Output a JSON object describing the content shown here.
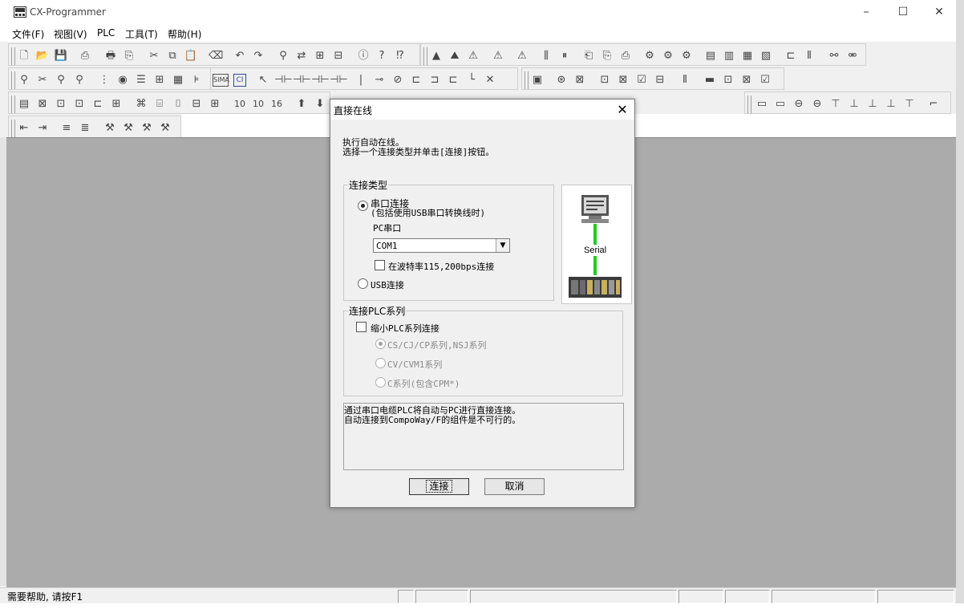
{
  "window": {
    "title": "CX-Programmer",
    "controls": {
      "minimize": "–",
      "maximize": "☐",
      "close": "✕"
    }
  },
  "menu": [
    {
      "label": "文件(F)"
    },
    {
      "label": "视图(V)"
    },
    {
      "label": "PLC"
    },
    {
      "label": "工具(T)"
    },
    {
      "label": "帮助(H)"
    }
  ],
  "toolbar": {
    "row2_labels": {
      "simatic": "SIMA",
      "ci": "CI"
    },
    "row3_labels": {
      "n10a": "10",
      "n10b": "10",
      "n16": "16"
    },
    "icons": [
      "new-file-icon",
      "open-folder-icon",
      "save-icon",
      "print-icon",
      "cut-icon",
      "copy-icon",
      "paste-icon",
      "undo-icon",
      "redo-icon",
      "find-icon",
      "info-icon",
      "help-icon",
      "context-help-icon",
      "zoom-icon",
      "select-icon",
      "contact-icon",
      "coil-icon",
      "line-icon"
    ]
  },
  "dialog": {
    "title": "直接在线",
    "intro_line1": "执行自动在线。",
    "intro_line2": "选择一个连接类型并单击[连接]按钮。",
    "connection_type": {
      "legend": "连接类型",
      "serial_label": "串口连接",
      "serial_note": "(包括使用USB串口转换线时)",
      "pc_port_label": "PC串口",
      "com_value": "COM1",
      "baud_checkbox_label": "在波特率115,200bps连接",
      "baud_checked": false,
      "usb_label": "USB连接",
      "selected": "serial"
    },
    "image": {
      "caption": "Serial",
      "accent_color": "#22cc22"
    },
    "plc_series": {
      "legend": "连接PLC系列",
      "narrow_label": "缩小PLC系列连接",
      "narrow_checked": false,
      "options": [
        {
          "label": "CS/CJ/CP系列,NSJ系列",
          "selected": true
        },
        {
          "label": "CV/CVM1系列",
          "selected": false
        },
        {
          "label": "C系列(包含CPM*)",
          "selected": false
        }
      ]
    },
    "description_line1": "通过串口电缆PLC将自动与PC进行直接连接。",
    "description_line2": "自动连接到CompoWay/F的组件是不可行的。",
    "buttons": {
      "connect": "连接",
      "cancel": "取消"
    }
  },
  "statusbar": {
    "text": "需要帮助, 请按F1"
  },
  "colors": {
    "mdi_background": "#ababab",
    "dialog_background": "#f0f0f0"
  }
}
